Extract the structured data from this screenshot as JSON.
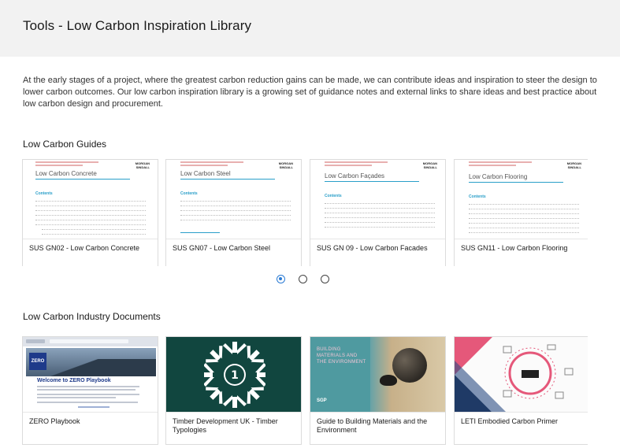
{
  "header": {
    "title": "Tools - Low Carbon Inspiration Library"
  },
  "intro": "At the early stages of a project, where the greatest carbon reduction gains can be made, we can contribute ideas and inspiration to steer the design to lower carbon outcomes. Our low carbon inspiration library is a growing set of guidance notes and external links to share ideas and best practice about low carbon design and procurement.",
  "guides": {
    "title": "Low Carbon Guides",
    "cards": [
      {
        "label": "SUS GN02 - Low Carbon Concrete",
        "doc_title": "Low Carbon Concrete"
      },
      {
        "label": "SUS GN07 - Low Carbon Steel",
        "doc_title": "Low Carbon Steel"
      },
      {
        "label": "SUS GN 09 - Low Carbon Facades",
        "doc_title": "Low Carbon Façades"
      },
      {
        "label": "SUS GN11 - Low Carbon Flooring",
        "doc_title": "Low Carbon Flooring"
      }
    ],
    "doc_logo": "MORGAN SINDALL",
    "doc_contents": "Contents",
    "pagination": {
      "pages": 3,
      "active": 0
    }
  },
  "industry": {
    "title": "Low Carbon Industry Documents",
    "cards": [
      {
        "label": "ZERO Playbook"
      },
      {
        "label": "Timber Development UK - Timber Typologies"
      },
      {
        "label": "Guide to Building Materials and the Environment"
      },
      {
        "label": "LETI Embodied Carbon Primer"
      }
    ],
    "zero": {
      "badge": "ZERO",
      "heading": "Welcome to ZERO Playbook"
    },
    "timber": {
      "number": "1"
    },
    "bme": {
      "heading": "BUILDING MATERIALS AND THE ENVIRONMENT",
      "brand": "SGP"
    }
  },
  "colors": {
    "header_bg": "#f2f2f2",
    "accent_blue": "#2a9fc9",
    "active_dot": "#2b7bd4",
    "timber_green": "#11463f",
    "leti_pink": "#e5587a",
    "leti_navy": "#1f3a66"
  }
}
